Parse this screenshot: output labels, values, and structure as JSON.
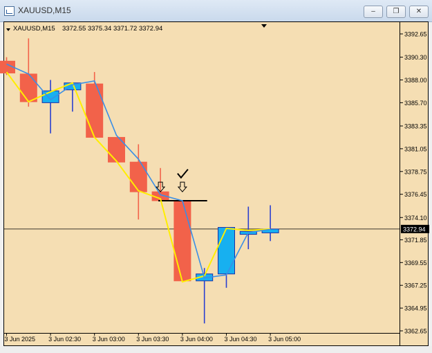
{
  "window": {
    "title": "XAUUSD,M15",
    "minimize_glyph": "–",
    "restore_glyph": "❐",
    "close_glyph": "✕"
  },
  "chart_header": {
    "symbol": "XAUUSD,M15",
    "ohlc": "3372.55 3375.34 3371.72 3372.94"
  },
  "colors": {
    "background": "#f5deb3",
    "bull_fill": "#17b0f0",
    "bear_fill": "#f2624a",
    "blue_line": "#3a8ee6",
    "yellow_line": "#ffee00",
    "price_line": "#000000"
  },
  "chart_data": {
    "type": "candlestick",
    "title": "",
    "xlabel": "",
    "ylabel": "",
    "ylim": [
      3362.65,
      3392.65
    ],
    "y_ticks": [
      "3392.65",
      "3390.30",
      "3388.00",
      "3385.70",
      "3383.35",
      "3381.05",
      "3378.75",
      "3376.45",
      "3374.10",
      "3371.85",
      "3369.55",
      "3367.25",
      "3364.95",
      "3362.65"
    ],
    "x_ticks": [
      {
        "index": 0,
        "label": "3 Jun 2025"
      },
      {
        "index": 2,
        "label": "3 Jun 02:30"
      },
      {
        "index": 4,
        "label": "3 Jun 03:00"
      },
      {
        "index": 6,
        "label": "3 Jun 03:30"
      },
      {
        "index": 8,
        "label": "3 Jun 04:00"
      },
      {
        "index": 10,
        "label": "3 Jun 04:30"
      },
      {
        "index": 12,
        "label": "3 Jun 05:00"
      }
    ],
    "current_price": "3372.94",
    "candles": [
      {
        "o": 3389.9,
        "h": 3390.3,
        "l": 3388.5,
        "c": 3388.7
      },
      {
        "o": 3388.6,
        "h": 3392.2,
        "l": 3385.3,
        "c": 3385.8
      },
      {
        "o": 3385.7,
        "h": 3388.0,
        "l": 3382.6,
        "c": 3386.9
      },
      {
        "o": 3387.0,
        "h": 3387.7,
        "l": 3384.8,
        "c": 3387.7
      },
      {
        "o": 3387.6,
        "h": 3388.8,
        "l": 3382.2,
        "c": 3382.2
      },
      {
        "o": 3382.2,
        "h": 3382.2,
        "l": 3379.8,
        "c": 3379.7
      },
      {
        "o": 3379.7,
        "h": 3381.5,
        "l": 3373.9,
        "c": 3376.7
      },
      {
        "o": 3376.7,
        "h": 3379.1,
        "l": 3375.8,
        "c": 3375.8
      },
      {
        "o": 3375.8,
        "h": 3375.8,
        "l": 3367.7,
        "c": 3367.7
      },
      {
        "o": 3367.7,
        "h": 3369.0,
        "l": 3363.4,
        "c": 3368.4
      },
      {
        "o": 3368.4,
        "h": 3373.1,
        "l": 3367.0,
        "c": 3373.1
      },
      {
        "o": 3372.4,
        "h": 3375.2,
        "l": 3370.9,
        "c": 3372.7
      },
      {
        "o": 3372.55,
        "h": 3375.34,
        "l": 3371.72,
        "c": 3372.94
      }
    ],
    "blue_line": [
      3389.6,
      3388.6,
      3386.0,
      3387.5,
      3387.9,
      3382.4,
      3380.0,
      3376.4,
      3375.8,
      3368.0,
      3368.3,
      3372.6,
      3372.9
    ],
    "yellow_line": [
      3388.8,
      3385.8,
      3386.8,
      3387.7,
      3382.2,
      3379.8,
      3376.8,
      3376.0,
      3367.6,
      3368.2,
      3373.0,
      3372.8,
      3372.94
    ],
    "markers": [
      {
        "type": "arrow-down",
        "index": 7,
        "price": 3376.7
      },
      {
        "type": "arrow-down",
        "index": 8,
        "price": 3376.7
      },
      {
        "type": "check",
        "index": 8,
        "price": 3378.2
      }
    ],
    "hline": {
      "price": 3375.8,
      "from_index": 7,
      "to_index": 9
    }
  }
}
